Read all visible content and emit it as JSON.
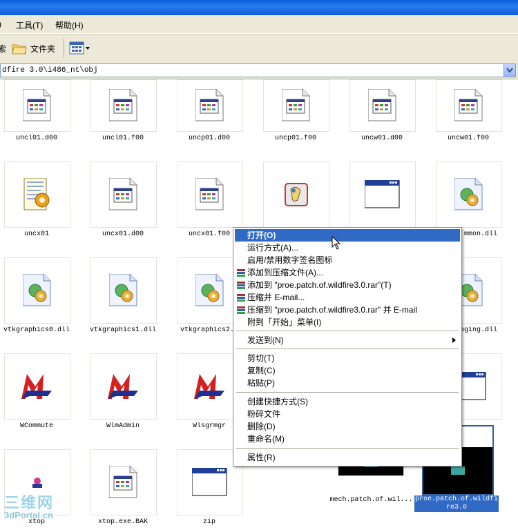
{
  "menubar": {
    "items": [
      "工具(T)",
      "帮助(H)"
    ]
  },
  "toolbar": {
    "folders_label": "文件夹"
  },
  "address": {
    "path": "dfire 3.0\\i486_nt\\obj"
  },
  "files": [
    {
      "name": "uncl01.d00",
      "icon": "document-icon"
    },
    {
      "name": "uncl01.f00",
      "icon": "document-icon"
    },
    {
      "name": "uncp01.d00",
      "icon": "document-icon"
    },
    {
      "name": "uncp01.f00",
      "icon": "document-icon"
    },
    {
      "name": "uncw01.d00",
      "icon": "document-icon"
    },
    {
      "name": "uncw01.f00",
      "icon": "document-icon"
    },
    {
      "name": "uncx01",
      "icon": "settings-file-icon"
    },
    {
      "name": "uncx01.d00",
      "icon": "document-icon"
    },
    {
      "name": "uncx01.f00",
      "icon": "document-icon"
    },
    {
      "name": "",
      "icon": "app-icon"
    },
    {
      "name": "",
      "icon": "window-icon"
    },
    {
      "name": "mmon.dll",
      "icon": "dll-icon"
    },
    {
      "name": "vtkgraphics0.dll",
      "icon": "dll-icon"
    },
    {
      "name": "vtkgraphics1.dll",
      "icon": "dll-icon"
    },
    {
      "name": "vtkgraphics2.d",
      "icon": "dll-icon"
    },
    {
      "name": "aging.dll",
      "icon": "dll-icon"
    },
    {
      "name": "WCommute",
      "icon": "lm-logo-icon"
    },
    {
      "name": "WlmAdmin",
      "icon": "lm-logo-icon"
    },
    {
      "name": "Wlsgrmgr",
      "icon": "lm-logo-icon"
    },
    {
      "name": "xtop",
      "icon": "xtop-icon"
    },
    {
      "name": "xtop.exe.BAK",
      "icon": "document-icon"
    },
    {
      "name": "zip",
      "icon": "window-icon"
    },
    {
      "name": "mech.patch.of.wil...",
      "icon": "window-icon"
    },
    {
      "name": "proe.patch.of.wildfire3.0",
      "icon": "window-icon"
    }
  ],
  "context_menu": {
    "items": [
      "打开(O)",
      "运行方式(A)...",
      "启用/禁用数字签名图标",
      "添加到压缩文件(A)...",
      "添加到 \"proe.patch.of.wildfire3.0.rar\"(T)",
      "压缩并 E-mail...",
      "压缩到 \"proe.patch.of.wildfire3.0.rar\" 并 E-mail",
      "附到「开始」菜单(I)",
      "发送到(N)",
      "剪切(T)",
      "复制(C)",
      "粘贴(P)",
      "创建快捷方式(S)",
      "粉碎文件",
      "删除(D)",
      "重命名(M)",
      "属性(R)"
    ]
  },
  "watermark": {
    "line1": "三维网",
    "line2": "3dPortal.cn"
  }
}
